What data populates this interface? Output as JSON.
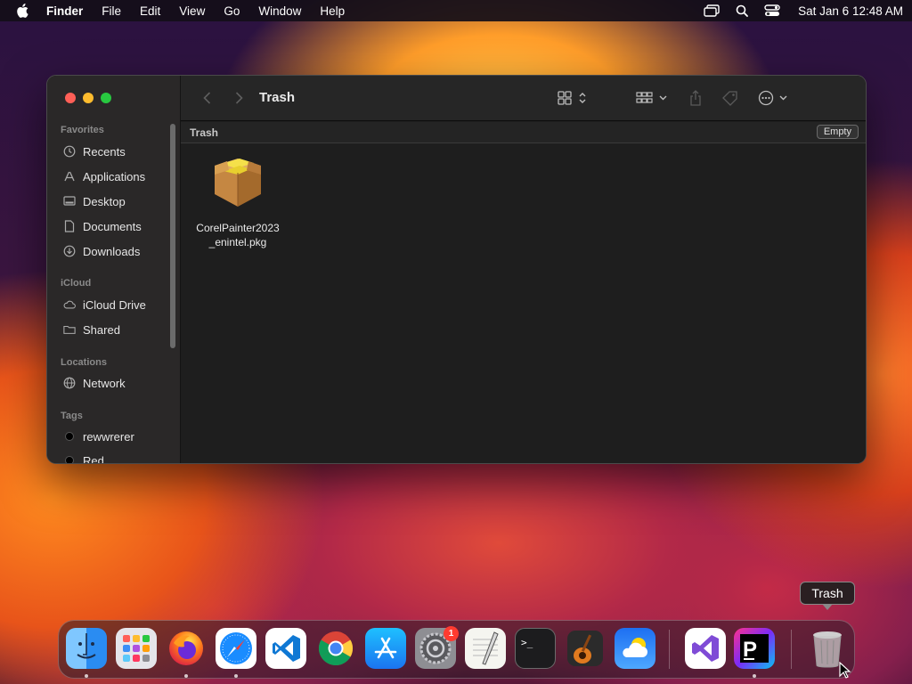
{
  "menubar": {
    "app_name": "Finder",
    "items": [
      "File",
      "Edit",
      "View",
      "Go",
      "Window",
      "Help"
    ],
    "clock": "Sat Jan 6  12:48 AM"
  },
  "window": {
    "title": "Trash",
    "path_label": "Trash",
    "empty_button": "Empty",
    "sidebar": {
      "favorites_header": "Favorites",
      "favorites": [
        "Recents",
        "Applications",
        "Desktop",
        "Documents",
        "Downloads"
      ],
      "icloud_header": "iCloud",
      "icloud": [
        "iCloud Drive",
        "Shared"
      ],
      "locations_header": "Locations",
      "locations": [
        "Network"
      ],
      "tags_header": "Tags",
      "tags": [
        "rewwrerer",
        "Red"
      ]
    },
    "files": [
      {
        "name_line1": "CorelPainter2023",
        "name_line2": "_enintel.pkg",
        "icon": "package-icon"
      }
    ]
  },
  "dock": {
    "apps": [
      "Finder",
      "Launchpad",
      "Firefox",
      "Safari",
      "Visual Studio Code",
      "Google Chrome",
      "App Store",
      "System Settings",
      "TextEdit",
      "Terminal",
      "GarageBand",
      "Weather",
      "Visual Studio",
      "PhpStorm",
      "Trash"
    ],
    "settings_badge": "1",
    "tooltip": "Trash"
  }
}
